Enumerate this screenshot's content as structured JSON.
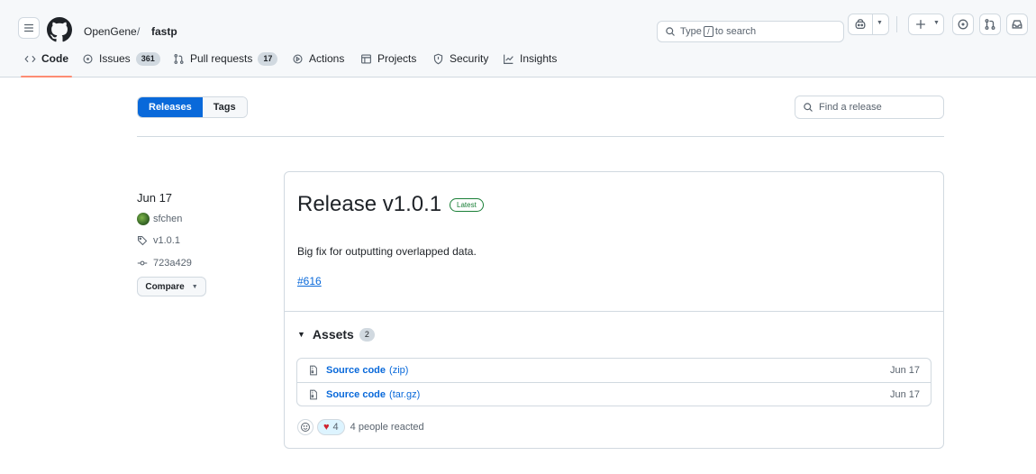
{
  "header": {
    "owner": "OpenGene",
    "separator": "/",
    "repo": "fastp",
    "search": {
      "prefix": "Type",
      "key": "/",
      "suffix": "to search"
    }
  },
  "tabs": [
    {
      "label": "Code",
      "icon": "code-icon",
      "active": true
    },
    {
      "label": "Issues",
      "icon": "issue-opened-icon",
      "count": "361"
    },
    {
      "label": "Pull requests",
      "icon": "git-pull-request-icon",
      "count": "17"
    },
    {
      "label": "Actions",
      "icon": "play-icon"
    },
    {
      "label": "Projects",
      "icon": "table-icon"
    },
    {
      "label": "Security",
      "icon": "shield-icon"
    },
    {
      "label": "Insights",
      "icon": "graph-icon"
    }
  ],
  "releases_nav": {
    "releases_label": "Releases",
    "tags_label": "Tags",
    "find_placeholder": "Find a release"
  },
  "release": {
    "date": "Jun 17",
    "author": "sfchen",
    "tag": "v1.0.1",
    "commit": "723a429",
    "compare_label": "Compare",
    "title": "Release v1.0.1",
    "badge": "Latest",
    "body": "Big fix for outputting overlapped data.",
    "link": "#616",
    "assets_label": "Assets",
    "assets_count": "2",
    "assets": [
      {
        "name": "Source code",
        "ext": "(zip)",
        "date": "Jun 17"
      },
      {
        "name": "Source code",
        "ext": "(tar.gz)",
        "date": "Jun 17"
      }
    ],
    "reaction_count": "4",
    "reaction_text": "4 people reacted"
  },
  "colors": {
    "accent": "#0969da",
    "latest": "#1a7f37",
    "active_tab": "#fd8c73",
    "heart": "#cf222e"
  }
}
